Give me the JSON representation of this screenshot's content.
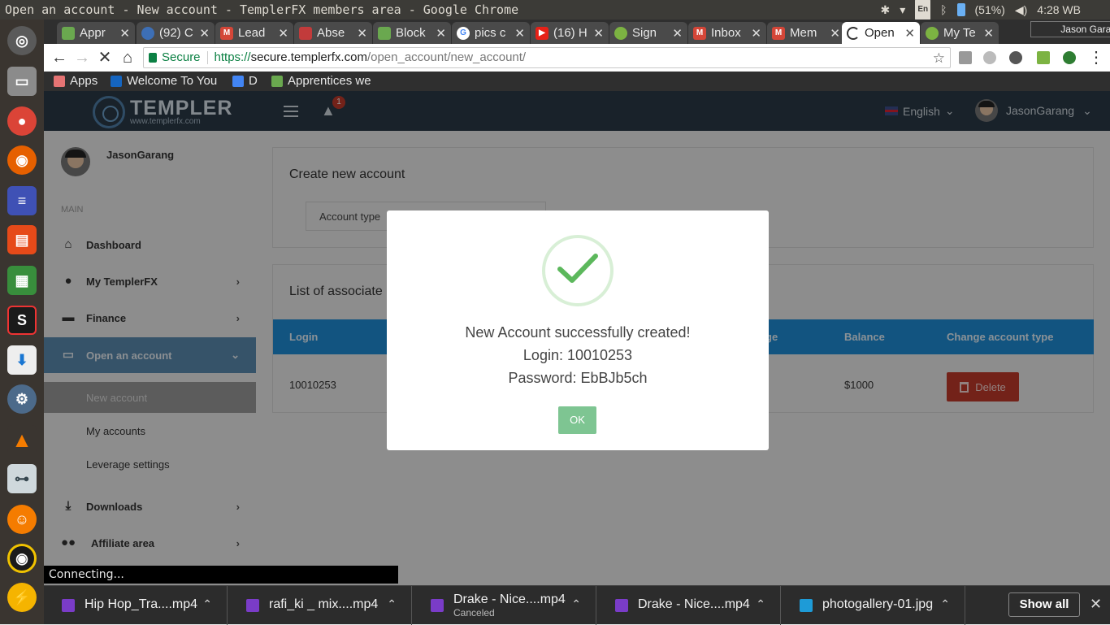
{
  "os": {
    "window_title": "Open an account - New account - TemplerFX members area - Google Chrome",
    "keyboard": "En",
    "battery": "(51%)",
    "clock": "4:28 WB"
  },
  "chrome": {
    "profile": "Jason Garang",
    "tabs": [
      {
        "label": "Appr",
        "color": "#6aa84f"
      },
      {
        "label": "(92) C",
        "color": "#3d6fb6"
      },
      {
        "label": "Lead",
        "color": "#d44638"
      },
      {
        "label": "Abse",
        "color": "#c23b3b"
      },
      {
        "label": "Block",
        "color": "#6aa84f"
      },
      {
        "label": "pics c",
        "color": "#4285f4"
      },
      {
        "label": "(16) H",
        "color": "#e62117"
      },
      {
        "label": "Sign",
        "color": "#7cb342"
      },
      {
        "label": "Inbox",
        "color": "#d44638"
      },
      {
        "label": "Mem",
        "color": "#d44638"
      },
      {
        "label": "Open",
        "color": "#333333"
      },
      {
        "label": "My Te",
        "color": "#7cb342"
      }
    ],
    "secure_label": "Secure",
    "url": {
      "scheme": "https://",
      "host": "secure.templerfx.com",
      "path": "/open_account/new_account/"
    },
    "bookmarks": [
      {
        "label": "Apps",
        "color": "#e57373"
      },
      {
        "label": "Welcome To You",
        "color": "#1565c0"
      },
      {
        "label": "D",
        "color": "#4285f4"
      },
      {
        "label": "Apprentices we",
        "color": "#6aa84f"
      }
    ]
  },
  "site": {
    "brand": "TEMPLER",
    "site_url": "www.templerfx.com",
    "alert_count": "1",
    "language": "English",
    "username": "JasonGarang"
  },
  "sidebar": {
    "username": "JasonGarang",
    "section": "MAIN",
    "items": [
      {
        "label": "Dashboard",
        "icon": "home-icon"
      },
      {
        "label": "My TemplerFX",
        "icon": "user-icon"
      },
      {
        "label": "Finance",
        "icon": "money-icon"
      },
      {
        "label": "Open an account",
        "icon": "monitor-icon"
      }
    ],
    "subitems": [
      "New account",
      "My accounts",
      "Leverage settings"
    ],
    "more_items": [
      {
        "label": "Downloads",
        "icon": "download-icon"
      },
      {
        "label": "Affiliate area",
        "icon": "group-icon"
      }
    ]
  },
  "main": {
    "create_title": "Create new account",
    "account_type_label": "Account type",
    "list_title": "List of associate",
    "columns": [
      "Login",
      "ge",
      "Balance",
      "Change account type"
    ],
    "row": {
      "login": "10010253",
      "balance": "$1000",
      "action": "Delete"
    }
  },
  "modal": {
    "line1": "New Account successfully created!",
    "line2": "Login: 10010253",
    "line3": "Password: EbBJb5ch",
    "ok": "OK"
  },
  "status_bar": "Connecting...",
  "downloads": [
    {
      "name": "Hip Hop_Tra....mp4",
      "status": ""
    },
    {
      "name": "rafi_ki _ mix....mp4",
      "status": ""
    },
    {
      "name": "Drake - Nice....mp4",
      "status": "Canceled"
    },
    {
      "name": "Drake - Nice....mp4",
      "status": ""
    },
    {
      "name": "photogallery-01.jpg",
      "status": ""
    }
  ],
  "show_all": "Show all"
}
